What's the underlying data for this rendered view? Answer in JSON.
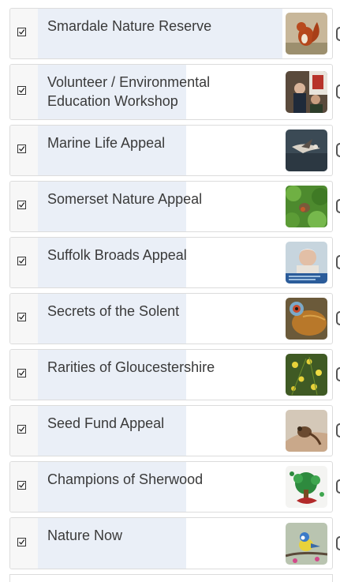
{
  "appeals": [
    {
      "name": "Smardale Nature Reserve",
      "checked": true,
      "thumbnail": "red-squirrel-photo"
    },
    {
      "name": "Volunteer / Environmental Education Workshop",
      "checked": true,
      "thumbnail": "volunteer-workshop-photo"
    },
    {
      "name": "Marine Life Appeal",
      "checked": true,
      "thumbnail": "seabird-photo"
    },
    {
      "name": "Somerset Nature Appeal",
      "checked": true,
      "thumbnail": "songbird-foliage-photo"
    },
    {
      "name": "Suffolk Broads Appeal",
      "checked": true,
      "thumbnail": "presenter-portrait-photo"
    },
    {
      "name": "Secrets of the Solent",
      "checked": true,
      "thumbnail": "fish-closeup-photo"
    },
    {
      "name": "Rarities of Gloucestershire",
      "checked": true,
      "thumbnail": "yellow-flowers-photo"
    },
    {
      "name": "Seed Fund Appeal",
      "checked": true,
      "thumbnail": "hand-holding-animal-photo"
    },
    {
      "name": "Champions of Sherwood",
      "checked": true,
      "thumbnail": "sherwood-tree-logo"
    },
    {
      "name": "Nature Now",
      "checked": true,
      "thumbnail": "blue-tit-photo"
    }
  ],
  "colors": {
    "row_highlight": "#eaeff7",
    "checkbox_cell": "#f7f7f7",
    "text": "#3a3a3a",
    "border": "#dcdcdc"
  }
}
